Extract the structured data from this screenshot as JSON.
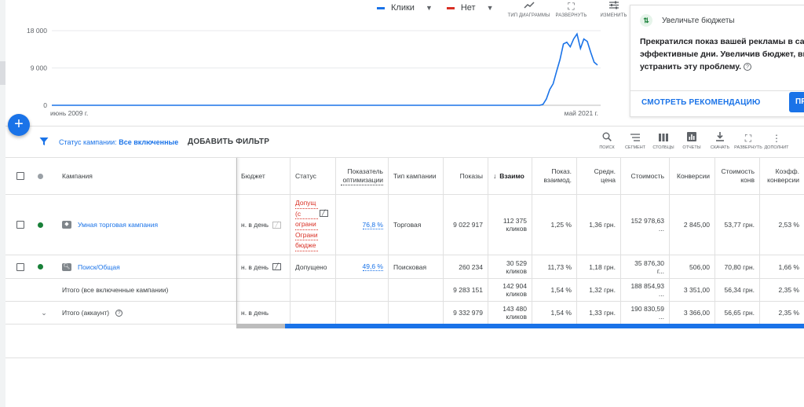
{
  "chart_toolbar": {
    "metric1": {
      "label": "Клики",
      "color": "#1a73e8"
    },
    "metric2": {
      "label": "Нет",
      "color": "#d93025"
    },
    "tools": [
      {
        "label": "ТИП ДИАГРАММЫ",
        "icon": "trend-icon"
      },
      {
        "label": "РАЗВЕРНУТЬ",
        "icon": "expand-icon"
      },
      {
        "label": "ИЗМЕНИТЬ",
        "icon": "tune-icon"
      }
    ]
  },
  "chart_data": {
    "type": "line",
    "y_ticks": [
      "18 000",
      "9 000",
      "0"
    ],
    "ylim": [
      0,
      18000
    ],
    "x_labels": [
      "июнь 2009 г.",
      "май 2021 г."
    ],
    "series": [
      {
        "color": "#1a73e8",
        "values": [
          0,
          0,
          0,
          0,
          0,
          0,
          0,
          0,
          0,
          0,
          0,
          0,
          0,
          0,
          0,
          0,
          0,
          0,
          0,
          0,
          0,
          0,
          0,
          0,
          0,
          0,
          0,
          0,
          0,
          0,
          0,
          0,
          0,
          0,
          0,
          0,
          0,
          0,
          0,
          0,
          0,
          0,
          0,
          0,
          0,
          0,
          0,
          0,
          0,
          0,
          0,
          0,
          0,
          0,
          0,
          0,
          0,
          0,
          0,
          0,
          0,
          0,
          0,
          0,
          0,
          0,
          0,
          0,
          0,
          0,
          0,
          0,
          0,
          0,
          0,
          0,
          0,
          0,
          0,
          0,
          0,
          0,
          0,
          0,
          0,
          0,
          0,
          0,
          0,
          0,
          0,
          0,
          0,
          0,
          0,
          0,
          0,
          0,
          0,
          0,
          0,
          0,
          0,
          0,
          0,
          0,
          0,
          0,
          0,
          0,
          0,
          0,
          0,
          0,
          0,
          0,
          0,
          0,
          0,
          0,
          0,
          0,
          0,
          0,
          0,
          0,
          0,
          0,
          0,
          0,
          0,
          0,
          0,
          0,
          0,
          0,
          0,
          0,
          0,
          0,
          0,
          0,
          0,
          0,
          200,
          1500,
          3800,
          5200,
          8200,
          11000,
          14800,
          15200,
          14100,
          16000,
          17200,
          13700,
          16000,
          15400,
          12800,
          10400,
          9700
        ]
      }
    ]
  },
  "recommendation": {
    "title": "Увеличьте бюджеты",
    "line1": "Прекратился показ вашей рекламы в сам",
    "line2": "эффективные дни. Увеличив бюджет, вы",
    "line3": "устранить эту проблему.",
    "link": "СМОТРЕТЬ РЕКОМЕНДАЦИЮ",
    "apply": "ПР"
  },
  "filter": {
    "status_prefix": "Статус кампании:",
    "status_value": "Все включенные",
    "add_filter": "ДОБАВИТЬ ФИЛЬТР"
  },
  "table_tools": [
    {
      "label": "ПОИСК",
      "icon": "search-icon"
    },
    {
      "label": "СЕГМЕНТ",
      "icon": "segment-icon"
    },
    {
      "label": "СТОЛБЦЫ",
      "icon": "columns-icon"
    },
    {
      "label": "ОТЧЕТЫ",
      "icon": "reports-icon"
    },
    {
      "label": "СКАЧАТЬ",
      "icon": "download-icon"
    },
    {
      "label": "РАЗВЕРНУТЬ",
      "icon": "expand-icon"
    },
    {
      "label": "ДОПОЛНИТ",
      "icon": "more-icon"
    }
  ],
  "headers": {
    "campaign": "Кампания",
    "budget": "Бюджет",
    "status": "Статус",
    "optimization": "Показатель оптимизации",
    "type": "Тип кампании",
    "impressions": "Показы",
    "interactions": "Взаимо",
    "interaction_rate": "Показ. взаимод.",
    "avg_cost": "Средн. цена",
    "cost": "Стоимость",
    "conversions": "Конверсии",
    "cost_per_conv": "Стоимость конв",
    "conv_rate": "Коэфф. конверсии"
  },
  "rows": [
    {
      "name": "Умная торговая кампания",
      "budget": "н. в день",
      "status_lines": [
        "Допущ",
        "(с",
        "ограни",
        "Ограни",
        "бюдже"
      ],
      "optimization": "76,8 %",
      "type": "Торговая",
      "impressions": "9 022 917",
      "interactions": "112 375 кликов",
      "interaction_rate": "1,25 %",
      "avg_cost": "1,36 грн.",
      "cost": "152 978,63 ...",
      "conversions": "2 845,00",
      "cost_per_conv": "53,77 грн.",
      "conv_rate": "2,53 %"
    },
    {
      "name": "Поиск/Общая",
      "budget": "н. в день",
      "status": "Допущено",
      "optimization": "49,6 %",
      "type": "Поисковая",
      "impressions": "260 234",
      "interactions": "30 529 кликов",
      "interaction_rate": "11,73 %",
      "avg_cost": "1,18 грн.",
      "cost": "35 876,30 г...",
      "conversions": "506,00",
      "cost_per_conv": "70,80 грн.",
      "conv_rate": "1,66 %"
    }
  ],
  "totals": [
    {
      "label": "Итого (все включенные кампании)",
      "budget": "",
      "impressions": "9 283 151",
      "interactions": "142 904 кликов",
      "interaction_rate": "1,54 %",
      "avg_cost": "1,32 грн.",
      "cost": "188 854,93 ...",
      "conversions": "3 351,00",
      "cost_per_conv": "56,34 грн.",
      "conv_rate": "2,35 %"
    },
    {
      "label": "Итого (аккаунт)",
      "budget": "н. в день",
      "impressions": "9 332 979",
      "interactions": "143 480 кликов",
      "interaction_rate": "1,54 %",
      "avg_cost": "1,33 грн.",
      "cost": "190 830,59 ...",
      "conversions": "3 366,00",
      "cost_per_conv": "56,65 грн.",
      "conv_rate": "2,35 %"
    }
  ]
}
